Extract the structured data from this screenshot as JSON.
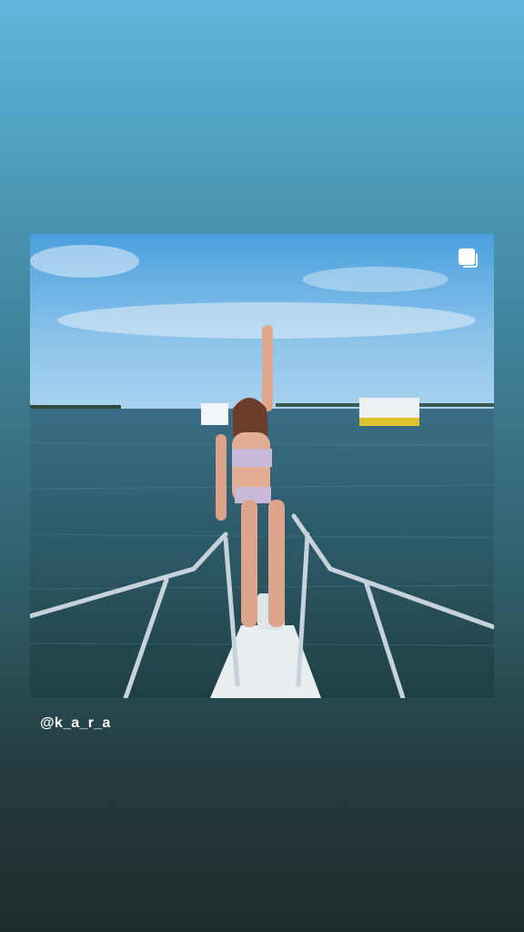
{
  "story": {
    "mention": "@k_a_r_a",
    "post_image_icon": "multiple-photos-icon"
  }
}
